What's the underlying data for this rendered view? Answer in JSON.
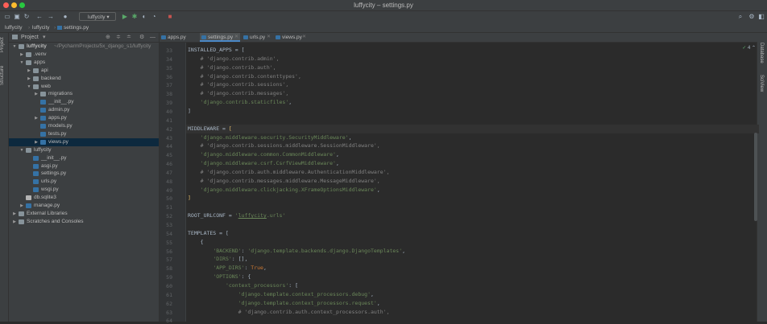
{
  "window": {
    "title": "luffycity – settings.py"
  },
  "toolbar": {
    "run_config": "luffycity"
  },
  "breadcrumbs": [
    "luffycity",
    "luffycity",
    "settings.py"
  ],
  "left_strip": {
    "project_tab": "Project",
    "structure_tab": "Structure"
  },
  "right_strip": {
    "database_tab": "Database",
    "sciview_tab": "SciView"
  },
  "project_panel": {
    "title": "Project",
    "tree": [
      {
        "label": "luffycity",
        "extra": "~/PycharmProjects/5x_django_s1/luffycity",
        "type": "folder",
        "depth": 0,
        "expanded": true
      },
      {
        "label": ".venv",
        "type": "folder",
        "depth": 1,
        "expanded": false
      },
      {
        "label": "apps",
        "type": "folder",
        "depth": 1,
        "expanded": true
      },
      {
        "label": "api",
        "type": "folder",
        "depth": 2,
        "expanded": false
      },
      {
        "label": "backend",
        "type": "folder",
        "depth": 2,
        "expanded": false
      },
      {
        "label": "web",
        "type": "folder",
        "depth": 2,
        "expanded": true
      },
      {
        "label": "migrations",
        "type": "folder",
        "depth": 3,
        "expanded": false
      },
      {
        "label": "__init__.py",
        "type": "py",
        "depth": 3
      },
      {
        "label": "admin.py",
        "type": "py",
        "depth": 3
      },
      {
        "label": "apps.py",
        "type": "py",
        "depth": 3,
        "arrow": true
      },
      {
        "label": "models.py",
        "type": "py",
        "depth": 3
      },
      {
        "label": "tests.py",
        "type": "py",
        "depth": 3
      },
      {
        "label": "views.py",
        "type": "py",
        "depth": 3,
        "arrow": true,
        "selected": true
      },
      {
        "label": "luffycity",
        "type": "folder",
        "depth": 1,
        "expanded": true
      },
      {
        "label": "__init__.py",
        "type": "py",
        "depth": 2
      },
      {
        "label": "asgi.py",
        "type": "py",
        "depth": 2
      },
      {
        "label": "settings.py",
        "type": "py",
        "depth": 2
      },
      {
        "label": "urls.py",
        "type": "py",
        "depth": 2
      },
      {
        "label": "wsgi.py",
        "type": "py",
        "depth": 2
      },
      {
        "label": "db.sqlite3",
        "type": "db",
        "depth": 1
      },
      {
        "label": "manage.py",
        "type": "py",
        "depth": 1,
        "arrow": true
      },
      {
        "label": "External Libraries",
        "type": "lib",
        "depth": 0,
        "expanded": false
      },
      {
        "label": "Scratches and Consoles",
        "type": "lib",
        "depth": 0,
        "expanded": false
      }
    ]
  },
  "editor": {
    "tabs": [
      {
        "label": "apps.py",
        "active": false
      },
      {
        "label": "settings.py",
        "active": true
      },
      {
        "label": "urls.py",
        "active": false
      },
      {
        "label": "views.py",
        "active": false
      }
    ],
    "warning_count": "4",
    "lines": [
      {
        "n": "33",
        "html": "INSTALLED_APPS = ["
      },
      {
        "n": "34",
        "html": "    <span class='c'># 'django.contrib.admin',</span>"
      },
      {
        "n": "35",
        "html": "    <span class='c'># 'django.contrib.auth',</span>"
      },
      {
        "n": "36",
        "html": "    <span class='c'># 'django.contrib.contenttypes',</span>"
      },
      {
        "n": "37",
        "html": "    <span class='c'># 'django.contrib.sessions',</span>"
      },
      {
        "n": "38",
        "html": "    <span class='c'># 'django.contrib.messages',</span>"
      },
      {
        "n": "39",
        "html": "    <span class='s'>'django.contrib.staticfiles'</span>,"
      },
      {
        "n": "40",
        "html": "]"
      },
      {
        "n": "41",
        "html": ""
      },
      {
        "n": "42",
        "html": "MIDDLEWARE = <span class='hl'>[</span>",
        "current": true
      },
      {
        "n": "43",
        "html": "    <span class='s'>'django.middleware.security.SecurityMiddleware'</span>,"
      },
      {
        "n": "44",
        "html": "    <span class='c'># 'django.contrib.sessions.middleware.SessionMiddleware',</span>"
      },
      {
        "n": "45",
        "html": "    <span class='s'>'django.middleware.common.CommonMiddleware'</span>,"
      },
      {
        "n": "46",
        "html": "    <span class='s'>'django.middleware.csrf.CsrfViewMiddleware'</span>,"
      },
      {
        "n": "47",
        "html": "    <span class='c'># 'django.contrib.auth.middleware.AuthenticationMiddleware',</span>"
      },
      {
        "n": "48",
        "html": "    <span class='c'># 'django.contrib.messages.middleware.MessageMiddleware',</span>"
      },
      {
        "n": "49",
        "html": "    <span class='s'>'django.middleware.clickjacking.XFrameOptionsMiddleware'</span>,"
      },
      {
        "n": "50",
        "html": "<span class='hl'>]</span>"
      },
      {
        "n": "51",
        "html": ""
      },
      {
        "n": "52",
        "html": "ROOT_URLCONF = <span class='s'>'<span class=\"u\">luffycity</span>.urls'</span>"
      },
      {
        "n": "53",
        "html": ""
      },
      {
        "n": "54",
        "html": "TEMPLATES = ["
      },
      {
        "n": "55",
        "html": "    {"
      },
      {
        "n": "56",
        "html": "        <span class='s'>'BACKEND'</span>: <span class='s'>'django.template.backends.django.DjangoTemplates'</span>,"
      },
      {
        "n": "57",
        "html": "        <span class='s'>'DIRS'</span>: [],"
      },
      {
        "n": "58",
        "html": "        <span class='s'>'APP_DIRS'</span>: <span class='k'>True</span>,"
      },
      {
        "n": "59",
        "html": "        <span class='s'>'OPTIONS'</span>: {"
      },
      {
        "n": "60",
        "html": "            <span class='s'>'context_processors'</span>: ["
      },
      {
        "n": "61",
        "html": "                <span class='s'>'django.template.context_processors.debug'</span>,"
      },
      {
        "n": "62",
        "html": "                <span class='s'>'django.template.context_processors.request'</span>,"
      },
      {
        "n": "63",
        "html": "                <span class='c'># 'django.contrib.auth.context_processors.auth',</span>"
      },
      {
        "n": "64",
        "html": ""
      }
    ]
  }
}
